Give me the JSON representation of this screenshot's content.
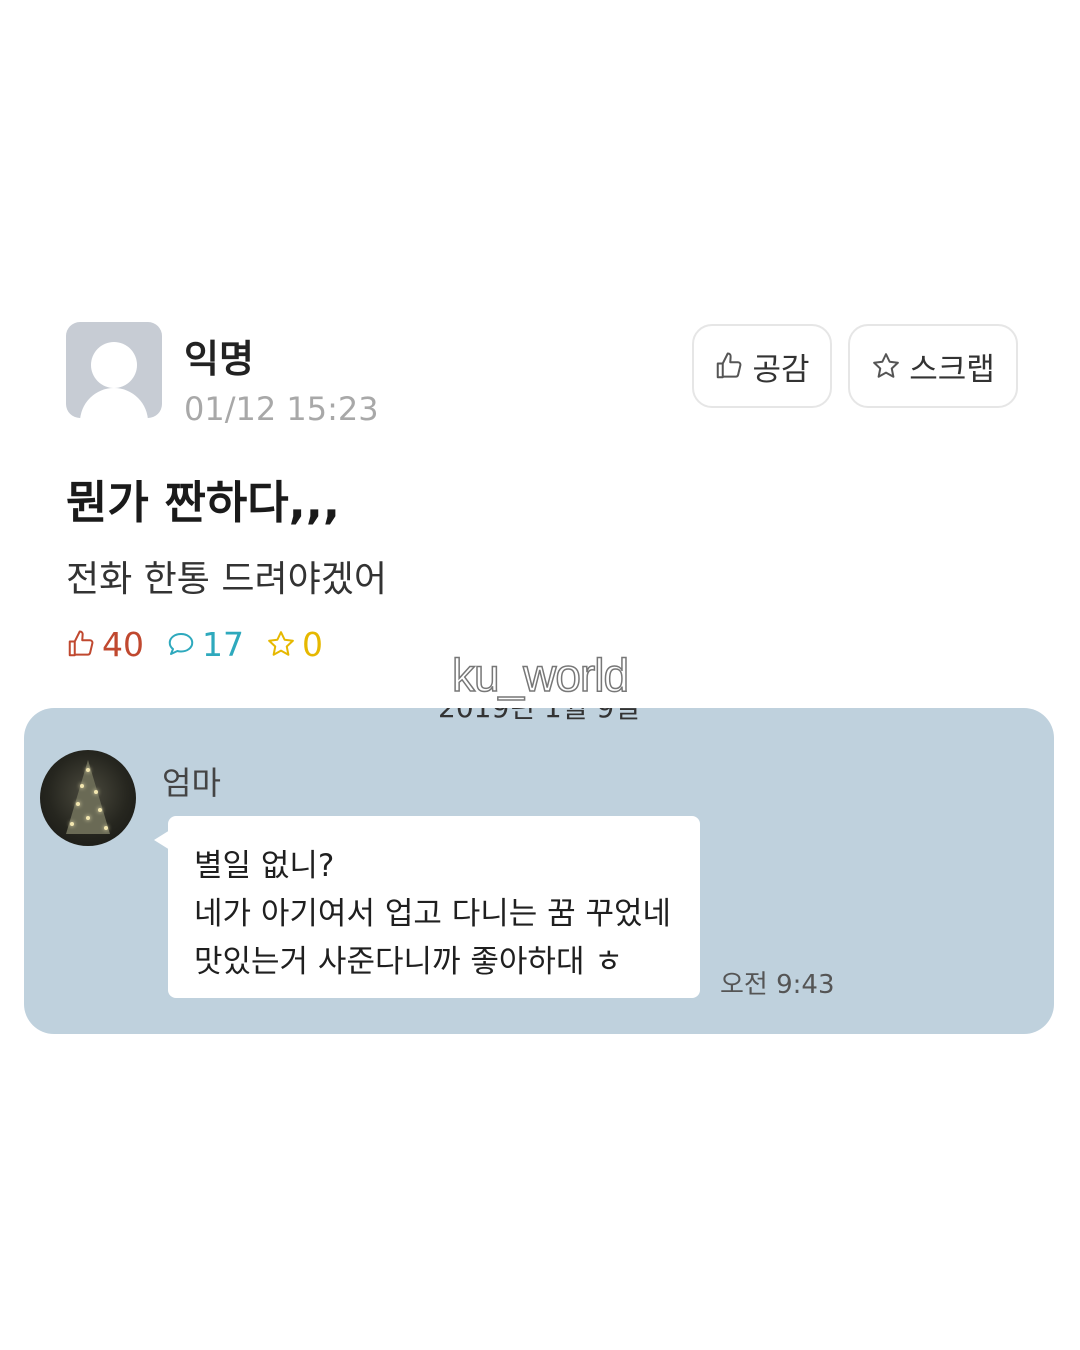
{
  "post": {
    "author": "익명",
    "timestamp": "01/12 15:23",
    "title": "뭔가 짠하다,,,",
    "body": "전화 한통 드려야겠어",
    "buttons": {
      "like_label": "공감",
      "scrap_label": "스크랩"
    },
    "stats": {
      "likes": "40",
      "comments": "17",
      "scraps": "0"
    },
    "icons": [
      "thumbs-up-icon",
      "star-icon",
      "speech-bubble-icon"
    ],
    "colors": {
      "likes": "#c0482f",
      "comments": "#2ea9bd",
      "scraps": "#e6b800"
    }
  },
  "watermark": "ku_world",
  "chat": {
    "date_divider": "2019년 1월 9일",
    "sender": "엄마",
    "message_lines": [
      "별일 없니?",
      "네가 아기여서 업고 다니는 꿈 꾸었네",
      "맛있는거 사준다니까 좋아하대 ㅎ"
    ],
    "time": "오전 9:43",
    "background_color": "#bfd1dd"
  }
}
